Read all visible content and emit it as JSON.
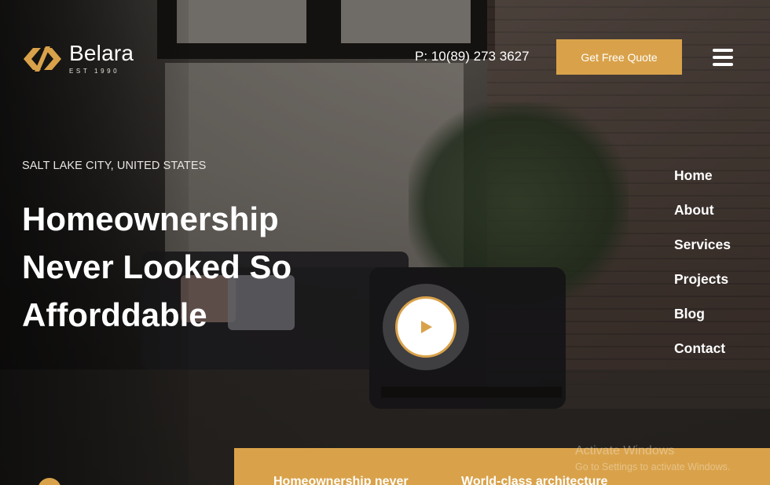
{
  "brand": {
    "name": "Belara",
    "established": "EST 1990",
    "accent_color": "#d9a24a"
  },
  "header": {
    "phone": "P: 10(89) 273 3627",
    "cta_label": "Get Free Quote",
    "menu_icon": "hamburger-menu-icon"
  },
  "hero": {
    "location": "SALT LAKE CITY, UNITED STATES",
    "headline_lines": [
      "Homeownership",
      "Never Looked So",
      "Afforddable"
    ],
    "play_icon": "play-icon"
  },
  "nav": {
    "items": [
      "Home",
      "About",
      "Services",
      "Projects",
      "Blog",
      "Contact"
    ]
  },
  "features": {
    "items": [
      "Homeownership never",
      "World-class architecture"
    ]
  },
  "watermark": {
    "title": "Activate Windows",
    "subtitle": "Go to Settings to activate Windows."
  }
}
